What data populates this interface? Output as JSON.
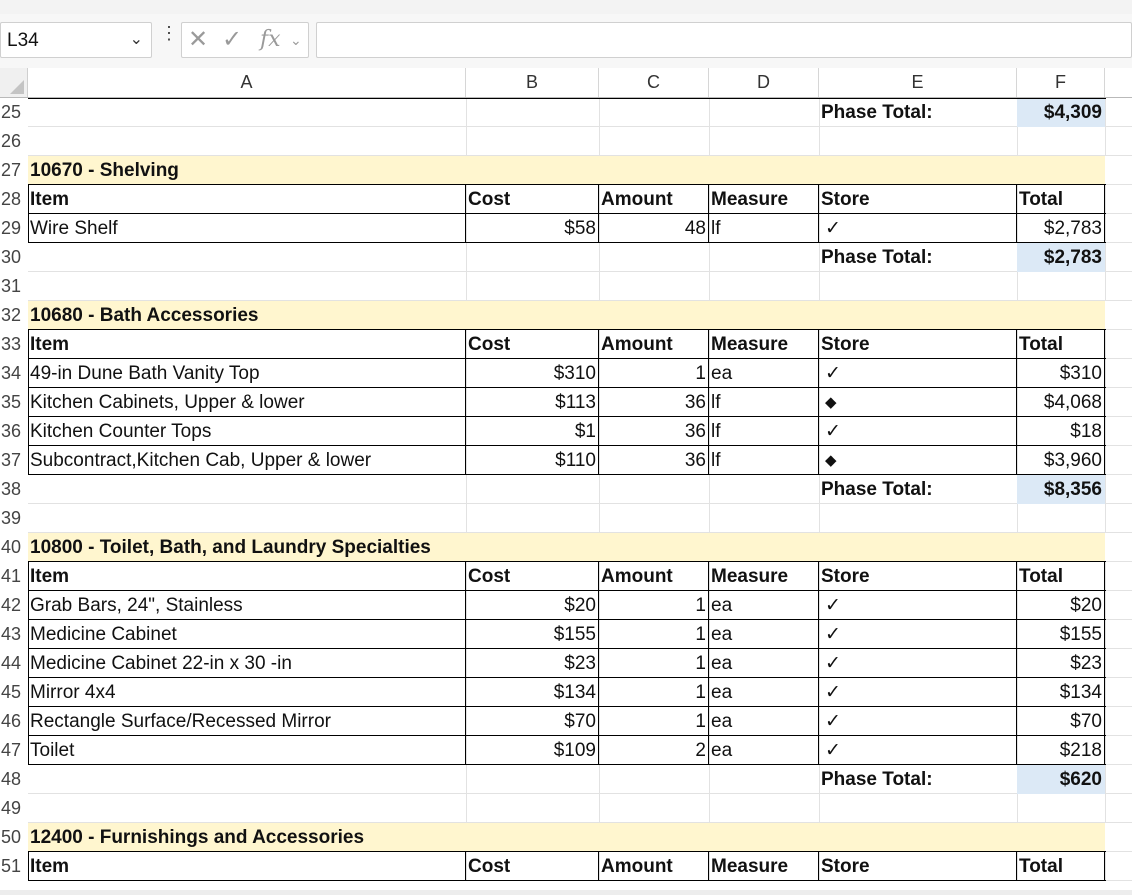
{
  "formula_bar": {
    "name_box": "L34",
    "fx_label": "fx",
    "formula": ""
  },
  "columns": [
    "A",
    "B",
    "C",
    "D",
    "E",
    "F"
  ],
  "phase_total_label": "Phase Total:",
  "header_labels": {
    "item": "Item",
    "cost": "Cost",
    "amount": "Amount",
    "measure": "Measure",
    "store": "Store",
    "total": "Total"
  },
  "rows": [
    {
      "num": "25",
      "type": "phase_total",
      "total": "$4,309"
    },
    {
      "num": "26",
      "type": "blank"
    },
    {
      "num": "27",
      "type": "section",
      "title": "10670 - Shelving"
    },
    {
      "num": "28",
      "type": "header"
    },
    {
      "num": "29",
      "type": "item",
      "item": "Wire Shelf",
      "cost": "$58",
      "amount": "48",
      "measure": "lf",
      "store": "✓",
      "total": "$2,783"
    },
    {
      "num": "30",
      "type": "phase_total",
      "total": "$2,783"
    },
    {
      "num": "31",
      "type": "blank"
    },
    {
      "num": "32",
      "type": "section",
      "title": "10680 - Bath Accessories"
    },
    {
      "num": "33",
      "type": "header"
    },
    {
      "num": "34",
      "type": "item",
      "item": "49-in Dune  Bath Vanity Top",
      "cost": "$310",
      "amount": "1",
      "measure": "ea",
      "store": "✓",
      "total": "$310"
    },
    {
      "num": "35",
      "type": "item",
      "item": "Kitchen Cabinets, Upper & lower",
      "cost": "$113",
      "amount": "36",
      "measure": "lf",
      "store": "◆",
      "total": "$4,068"
    },
    {
      "num": "36",
      "type": "item",
      "item": "Kitchen Counter Tops",
      "cost": "$1",
      "amount": "36",
      "measure": "lf",
      "store": "✓",
      "total": "$18"
    },
    {
      "num": "37",
      "type": "item",
      "item": "Subcontract,Kitchen Cab, Upper & lower",
      "cost": "$110",
      "amount": "36",
      "measure": "lf",
      "store": "◆",
      "total": "$3,960"
    },
    {
      "num": "38",
      "type": "phase_total",
      "total": "$8,356"
    },
    {
      "num": "39",
      "type": "blank"
    },
    {
      "num": "40",
      "type": "section",
      "title": "10800 - Toilet, Bath, and Laundry Specialties"
    },
    {
      "num": "41",
      "type": "header"
    },
    {
      "num": "42",
      "type": "item",
      "item": "Grab Bars, 24\", Stainless",
      "cost": "$20",
      "amount": "1",
      "measure": "ea",
      "store": "✓",
      "total": "$20"
    },
    {
      "num": "43",
      "type": "item",
      "item": "Medicine Cabinet",
      "cost": "$155",
      "amount": "1",
      "measure": "ea",
      "store": "✓",
      "total": "$155"
    },
    {
      "num": "44",
      "type": "item",
      "item": "Medicine Cabinet 22-in x 30 -in",
      "cost": "$23",
      "amount": "1",
      "measure": "ea",
      "store": "✓",
      "total": "$23"
    },
    {
      "num": "45",
      "type": "item",
      "item": "Mirror 4x4",
      "cost": "$134",
      "amount": "1",
      "measure": "ea",
      "store": "✓",
      "total": "$134"
    },
    {
      "num": "46",
      "type": "item",
      "item": "Rectangle Surface/Recessed Mirror",
      "cost": "$70",
      "amount": "1",
      "measure": "ea",
      "store": "✓",
      "total": "$70"
    },
    {
      "num": "47",
      "type": "item",
      "item": "Toilet",
      "cost": "$109",
      "amount": "2",
      "measure": "ea",
      "store": "✓",
      "total": "$218"
    },
    {
      "num": "48",
      "type": "phase_total",
      "total": "$620"
    },
    {
      "num": "49",
      "type": "blank"
    },
    {
      "num": "50",
      "type": "section",
      "title": "12400 - Furnishings and Accessories"
    },
    {
      "num": "51",
      "type": "header"
    }
  ]
}
